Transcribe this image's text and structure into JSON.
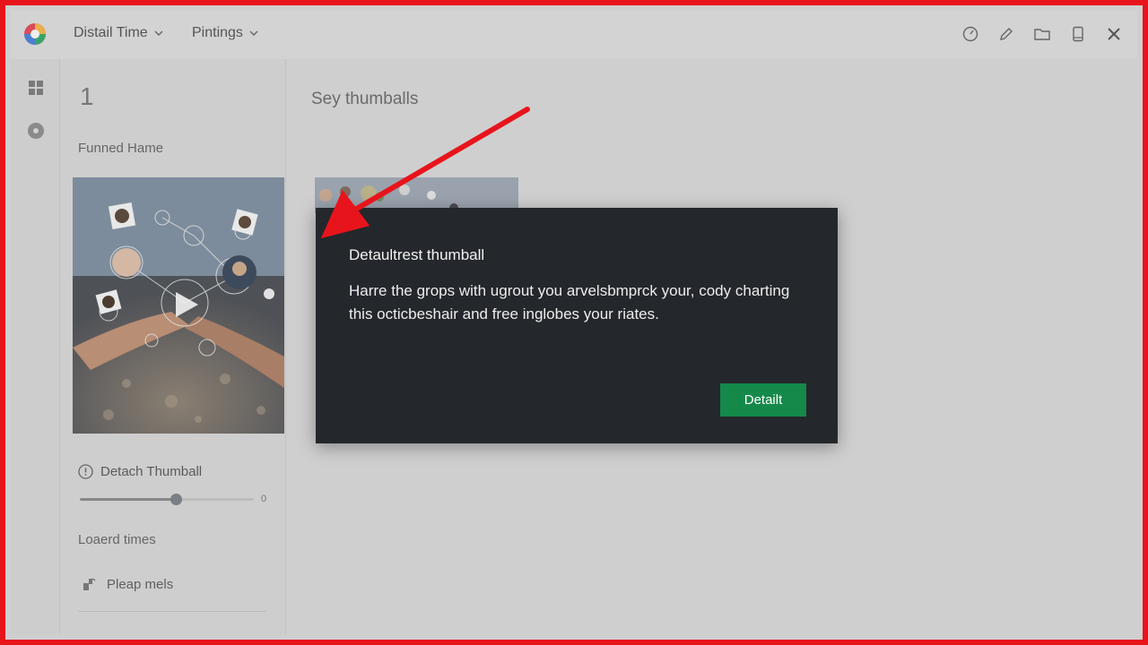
{
  "colors": {
    "frame_border": "#e8141c",
    "modal_bg": "#24272b",
    "primary_button": "#14894a",
    "annotation_arrow": "#e8141c"
  },
  "header": {
    "menus": [
      {
        "label": "Distail Time",
        "icon": "chevron-down-icon"
      },
      {
        "label": "Pintings",
        "icon": "chevron-down-icon"
      }
    ],
    "icons": [
      "dashboard-icon",
      "edit-icon",
      "folder-icon",
      "phone-icon",
      "close-icon"
    ]
  },
  "rail": {
    "icons": [
      "grid-icon",
      "record-icon"
    ]
  },
  "left_panel": {
    "count": "1",
    "subtitle": "Funned Hame",
    "detach_label": "Detach Thumball",
    "slider_value": 0.55,
    "slider_end_label": "0",
    "loaded_label": "Loaerd times",
    "pleap_label": "Pleap mels"
  },
  "main": {
    "title": "Sey thumballs"
  },
  "modal": {
    "title": "Detaultrest thumball",
    "body": "Harre the grops with ugrout you arvelsbmprck your, cody charting this octicbeshair and free inglobes your riates.",
    "button_label": "Detailt"
  }
}
